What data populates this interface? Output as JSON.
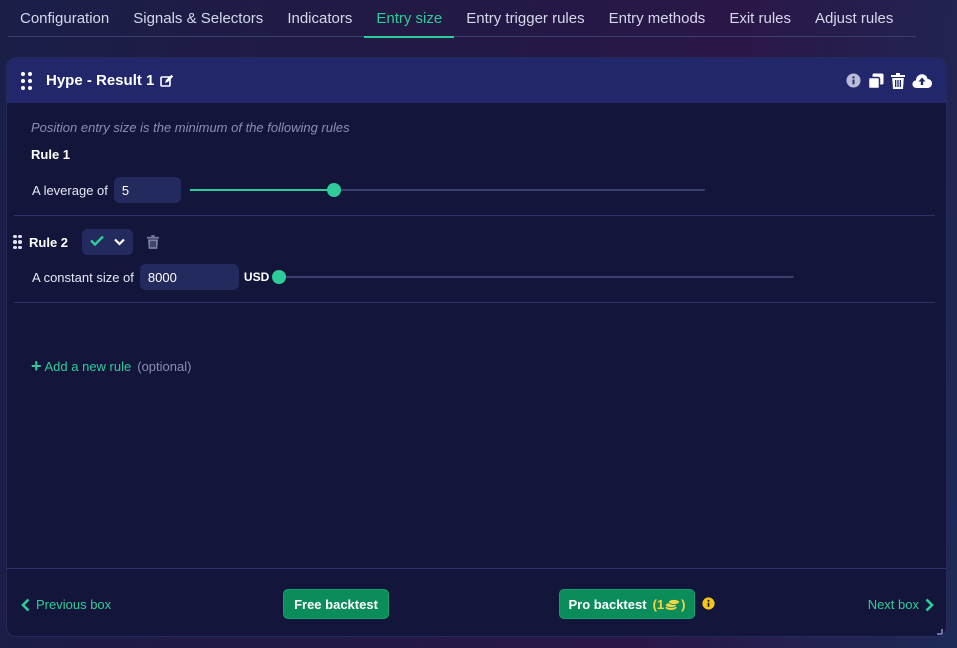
{
  "tabs": [
    {
      "label": "Configuration",
      "active": false
    },
    {
      "label": "Signals & Selectors",
      "active": false
    },
    {
      "label": "Indicators",
      "active": false
    },
    {
      "label": "Entry size",
      "active": true
    },
    {
      "label": "Entry trigger rules",
      "active": false
    },
    {
      "label": "Entry methods",
      "active": false
    },
    {
      "label": "Exit rules",
      "active": false
    },
    {
      "label": "Adjust rules",
      "active": false
    }
  ],
  "box": {
    "title": "Hype - Result 1",
    "hint": "Position entry size is the minimum of the following rules"
  },
  "rules": [
    {
      "title": "Rule 1",
      "label": "A leverage of",
      "value": "5",
      "slider_fraction": 0.28
    },
    {
      "title": "Rule 2",
      "label": "A constant size of",
      "value": "8000",
      "unit": "USD",
      "slider_fraction": 0.0
    }
  ],
  "add_rule": {
    "label": "Add a new rule",
    "optional": "(optional)"
  },
  "footer": {
    "previous": "Previous box",
    "next": "Next box",
    "free_backtest": "Free backtest",
    "pro_backtest": "Pro backtest",
    "pro_credits": "(1",
    "pro_credits_close": ")"
  },
  "colors": {
    "accent": "#2ecc9a",
    "header_bg": "#21276a",
    "box_bg": "#13163a",
    "button_bg": "#0b8c5b",
    "credits": "#f5d742"
  },
  "icons": [
    "grip-icon",
    "edit-icon",
    "info-icon",
    "copy-icon",
    "trash-icon",
    "cloud-upload-icon",
    "check-icon",
    "chevron-down-icon",
    "plus-icon",
    "chevron-left-icon",
    "chevron-right-icon",
    "coins-icon"
  ]
}
